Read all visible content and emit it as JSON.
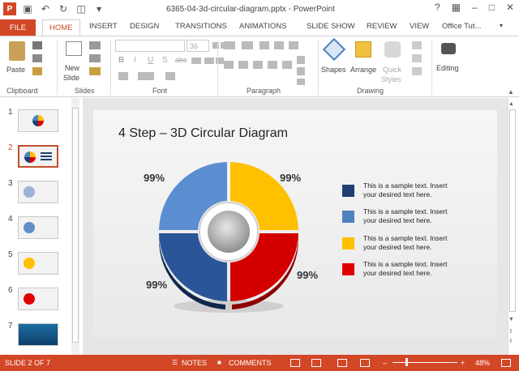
{
  "window": {
    "title": "6365-04-3d-circular-diagram.pptx - PowerPoint",
    "help": "?",
    "user": "Office Tut..."
  },
  "tabs": [
    "FILE",
    "HOME",
    "INSERT",
    "DESIGN",
    "TRANSITIONS",
    "ANIMATIONS",
    "SLIDE SHOW",
    "REVIEW",
    "VIEW"
  ],
  "ribbon": {
    "paste": "Paste",
    "new_slide_1": "New",
    "new_slide_2": "Slide",
    "font_size": "36",
    "shapes": "Shapes",
    "arrange": "Arrange",
    "quick_1": "Quick",
    "quick_2": "Styles",
    "editing": "Editing",
    "groups": [
      "Clipboard",
      "Slides",
      "Font",
      "Paragraph",
      "Drawing"
    ]
  },
  "thumbnails": [
    "1",
    "2",
    "3",
    "4",
    "5",
    "6",
    "7"
  ],
  "slide": {
    "title": "4 Step – 3D Circular Diagram",
    "percents": [
      "99%",
      "99%",
      "99%",
      "99%"
    ],
    "legend": [
      {
        "text": "This is a sample text. Insert your desired text here.",
        "color": "#1f3f72"
      },
      {
        "text": "This is a sample text. Insert your desired text here.",
        "color": "#4f81bd"
      },
      {
        "text": "This is a sample text. Insert your desired text here.",
        "color": "#ffc000"
      },
      {
        "text": "This is a sample text. Insert your desired text here.",
        "color": "#e00000"
      }
    ]
  },
  "status": {
    "slide": "SLIDE 2 OF 7",
    "notes": "NOTES",
    "comments": "COMMENTS",
    "zoom": "48%"
  },
  "colors": {
    "accent": "#d24726"
  }
}
